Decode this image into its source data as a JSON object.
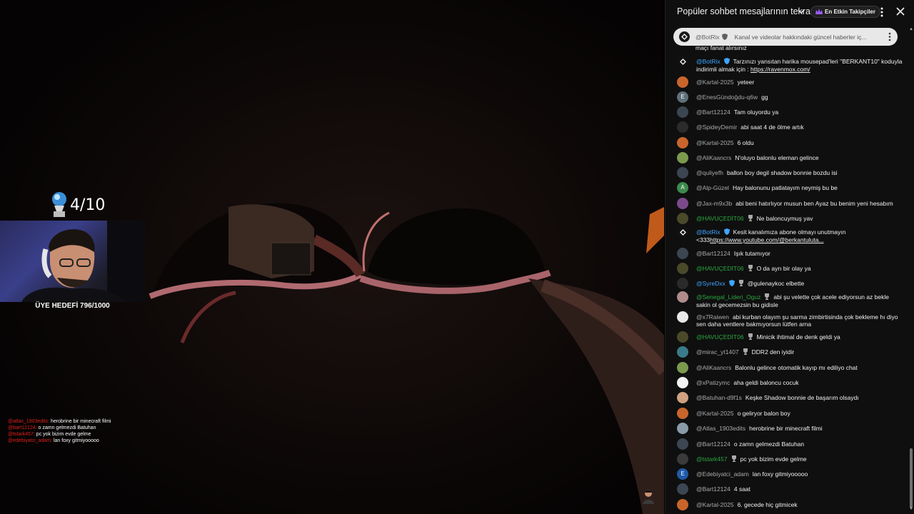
{
  "trophy": {
    "count": "4/10"
  },
  "member_goal": "ÜYE HEDEFİ 796/1000",
  "overlay_chat": [
    {
      "user": "@atlas_1903edits:",
      "text": "herobrine bir minecraft filmi"
    },
    {
      "user": "@bart12124:",
      "text": "o zamn gelmezdi Batuhan"
    },
    {
      "user": "@tstark457:",
      "text": "pc yok bizim evde gelme"
    },
    {
      "user": "@edebiyatci_adam:",
      "text": "lan foxy gitmiyooooo"
    }
  ],
  "chat": {
    "title": "Popüler sohbet mesajlarının tekrarı",
    "top_fans_label": "En Etkin Takipçiler",
    "pinned": {
      "user": "@BotRix",
      "text": "Kanal ve videolar hakkındaki güncel haberler iç..."
    },
    "partial_top": "maçı fanat alırsınız",
    "messages": [
      {
        "user": "@BotRix",
        "badge": "shield",
        "color": "blue",
        "avatar": "#111111",
        "text": "Tarzınızı yansıtan harika mousepad'leri \"BERKANT10\" koduyla indirimli almak için : ",
        "link": "https://ravenmox.com/"
      },
      {
        "user": "@Kartal-2025",
        "color": "gray",
        "avatar": "#c9652b",
        "text": "yeteer"
      },
      {
        "user": "@EnesGündoğdu-q6w",
        "color": "gray",
        "avatar": "#5f6f7a",
        "letter": "E",
        "text": "gg"
      },
      {
        "user": "@Bart12124",
        "color": "gray",
        "avatar": "#3c4652",
        "text": "Tam oluyordu ya"
      },
      {
        "user": "@SpideyDemir",
        "color": "gray",
        "avatar": "#2b2b2b",
        "text": "abi saat 4 de ölme artık"
      },
      {
        "user": "@Kartal-2025",
        "color": "gray",
        "avatar": "#c9652b",
        "text": "6 oldu"
      },
      {
        "user": "@AliKaancrs",
        "color": "gray",
        "avatar": "#7b9a4e",
        "text": "N'oluyo balonlu eleman gelince"
      },
      {
        "user": "@quliyefh",
        "color": "gray",
        "avatar": "#3c4652",
        "text": "ballon boy degil shadow bonnie bozdu isi"
      },
      {
        "user": "@Alp-Güzel",
        "color": "gray",
        "avatar": "#3c8a4e",
        "letter": "A",
        "text": "Hay balonunu patlatayım neymiş bu be"
      },
      {
        "user": "@Jax-m9x3b",
        "color": "gray",
        "avatar": "#7c4a8c",
        "text": "abi beni hatırlıyor musun ben Ayaz bu benim yeni hesabım"
      },
      {
        "user": "@HAVUÇEDİT06",
        "badge": "trophy",
        "color": "green",
        "avatar": "#4a4a2a",
        "text": "Ne baloncuymuş yav"
      },
      {
        "user": "@BotRix",
        "badge": "shield",
        "color": "blue",
        "avatar": "#111111",
        "text": "Kesit kanalımıza abone olmayı unutmayın <333",
        "link": "https://www.youtube.com/@berkantuluta..."
      },
      {
        "user": "@Bart12124",
        "color": "gray",
        "avatar": "#3c4652",
        "text": "Işık tutamıyor"
      },
      {
        "user": "@HAVUÇEDİT06",
        "badge": "trophy",
        "color": "green",
        "avatar": "#4a4a2a",
        "text": "O da ayrı bir olay ya"
      },
      {
        "user": "@SyreDxx",
        "badge": "shield-trophy",
        "color": "blue",
        "avatar": "#2a2a2a",
        "text": "@gulenaykoc elbette"
      },
      {
        "user": "@Senegal_Lideri_Oguz",
        "badge": "trophy",
        "color": "green",
        "avatar": "#b08b8b",
        "text": "abi şu velette çok acele ediyorsun az bekle sakin ol gecemezsin bu gidisle"
      },
      {
        "user": "@x7Raiwen",
        "color": "gray",
        "avatar": "#e8e8e8",
        "text": "abi kurban olayım şu sarma zimbirtisinda çok bekleme hı diyo sen daha ventlere bakmıyorsun lütfen arna"
      },
      {
        "user": "@HAVUÇEDİT06",
        "badge": "trophy",
        "color": "green",
        "avatar": "#4a4a2a",
        "text": "Minicik ihtimal de denk geldi ya"
      },
      {
        "user": "@mirac_yt1407",
        "badge": "trophy",
        "color": "gray",
        "avatar": "#3b7a8a",
        "text": "DDR2 den iyidir"
      },
      {
        "user": "@AliKaancrs",
        "color": "gray",
        "avatar": "#7b9a4e",
        "text": "Balonlu gelince otomatik kayıp mı ediliyo chat"
      },
      {
        "user": "@xPatizymc",
        "color": "gray",
        "avatar": "#f2f2f2",
        "text": "aha geldi baloncu cocuk"
      },
      {
        "user": "@Batuhan-d9f1s",
        "color": "gray",
        "avatar": "#d0a080",
        "text": "Keşke Shadow bonnie de başarım olsaydı"
      },
      {
        "user": "@Kartal-2025",
        "color": "gray",
        "avatar": "#c9652b",
        "text": "o geliryor balon boy"
      },
      {
        "user": "@Atlas_1903edits",
        "color": "gray",
        "avatar": "#8a9aa8",
        "text": "herobrine bir minecraft filmi"
      },
      {
        "user": "@Bart12124",
        "color": "gray",
        "avatar": "#3c4652",
        "text": "o zamn gelmezdi Batuhan"
      },
      {
        "user": "@tstark457",
        "badge": "trophy",
        "color": "green",
        "avatar": "#3a3a3a",
        "text": "pc yok bizim evde gelme"
      },
      {
        "user": "@Edebiyatci_adam",
        "color": "gray",
        "avatar": "#1e5aa8",
        "letter": "E",
        "text": "lan foxy gitmiyooooo"
      },
      {
        "user": "@Bart12124",
        "color": "gray",
        "avatar": "#3c4652",
        "text": "4 saat"
      },
      {
        "user": "@Kartal-2025",
        "color": "gray",
        "avatar": "#c9652b",
        "text": "6. gecede hiç gitmicek"
      }
    ]
  }
}
